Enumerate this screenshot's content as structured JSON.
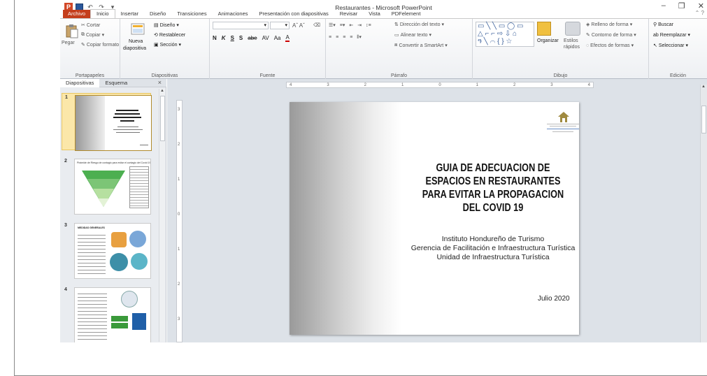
{
  "window": {
    "title": "Restaurantes - Microsoft PowerPoint"
  },
  "tabs": [
    "Archivo",
    "Inicio",
    "Insertar",
    "Diseño",
    "Transiciones",
    "Animaciones",
    "Presentación con diapositivas",
    "Revisar",
    "Vista",
    "PDFelement"
  ],
  "ribbon": {
    "portapapeles": {
      "label": "Portapapeles",
      "paste": "Pegar",
      "cut": "Cortar",
      "copy": "Copiar",
      "format_painter": "Copiar formato"
    },
    "diapositivas": {
      "label": "Diapositivas",
      "new_slide": "Nueva",
      "new_slide2": "diapositiva",
      "layout": "Diseño",
      "reset": "Restablecer",
      "section": "Sección"
    },
    "fuente": {
      "label": "Fuente",
      "b": "N",
      "i": "K",
      "u": "S",
      "s": "S",
      "abe": "abe",
      "av": "AV",
      "aa": "Aa",
      "a": "A"
    },
    "parrafo": {
      "label": "Párrafo",
      "text_dir": "Dirección del texto",
      "align_text": "Alinear texto",
      "smartart": "Convertir a SmartArt"
    },
    "dibujo": {
      "label": "Dibujo",
      "arrange": "Organizar",
      "styles": "Estilos",
      "styles2": "rápidos",
      "fill": "Relleno de forma",
      "outline": "Contorno de forma",
      "effects": "Efectos de formas"
    },
    "edicion": {
      "label": "Edición",
      "find": "Buscar",
      "replace": "Reemplazar",
      "select": "Seleccionar"
    }
  },
  "pane": {
    "tabs": [
      "Diapositivas",
      "Esquema"
    ],
    "close": "×",
    "slides": [
      {
        "num": "1"
      },
      {
        "num": "2",
        "title": "Pirámide de Riesgo de contagio para evitar el contagio del Covid 19"
      },
      {
        "num": "3",
        "title": "MEDIDAS GENERALES"
      },
      {
        "num": "4"
      }
    ]
  },
  "ruler": {
    "h": [
      "4",
      "3",
      "2",
      "1",
      "0",
      "1",
      "2",
      "3",
      "4"
    ],
    "v": [
      "3",
      "2",
      "1",
      "0",
      "1",
      "2",
      "3"
    ]
  },
  "slide": {
    "title": "GUIA DE ADECUACION DE ESPACIOS EN RESTAURANTES PARA EVITAR LA PROPAGACION DEL COVID 19",
    "org1": "Instituto Hondureño de Turismo",
    "org2": "Gerencia de Facilitación e Infraestructura Turística",
    "org3": "Unidad de Infraestructura Turística",
    "date": "Julio 2020"
  },
  "colors": {
    "file_tab": "#c43e1c",
    "selected_slide": "#fbe7a9",
    "slide_gradient": "#9a9a9a"
  }
}
